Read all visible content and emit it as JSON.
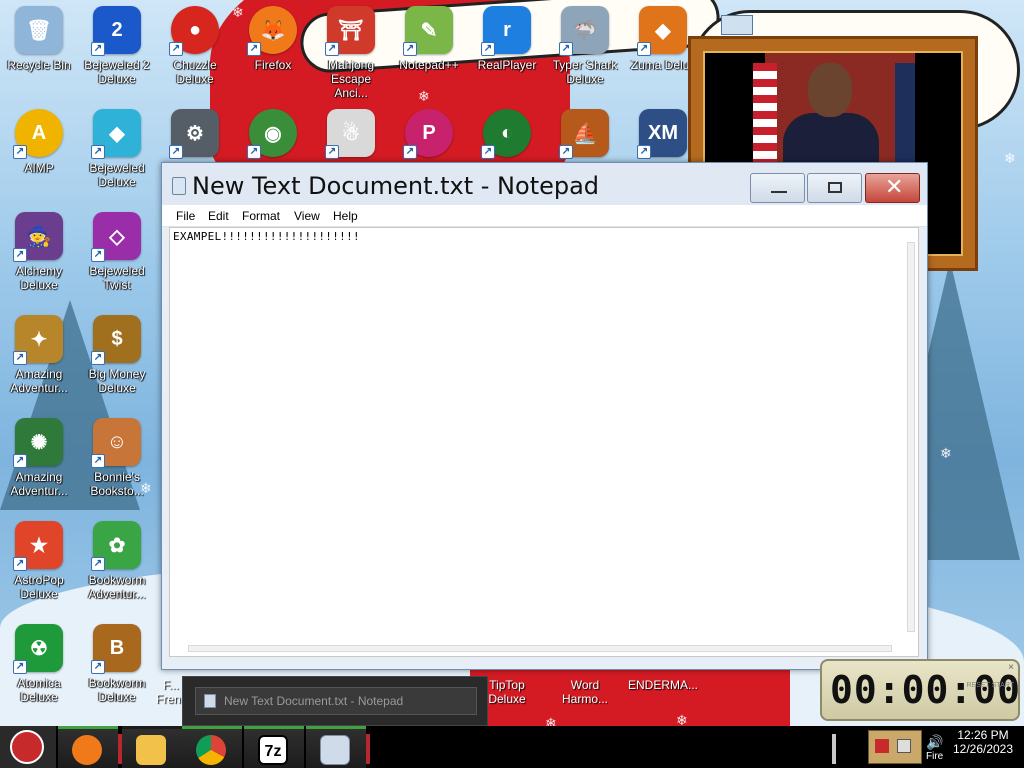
{
  "desktop_icons": [
    {
      "id": "recycle-bin",
      "label": "Recycle Bin",
      "glyph": "🗑",
      "color": "#8fb5d8"
    },
    {
      "id": "bejeweled-2-deluxe",
      "label": "Bejeweled 2 Deluxe",
      "glyph": "2",
      "color": "#1b58c9"
    },
    {
      "id": "chuzzle-deluxe",
      "label": "Chuzzle Deluxe",
      "glyph": "●",
      "color": "#d7261e"
    },
    {
      "id": "firefox",
      "label": "Firefox",
      "glyph": "🦊",
      "color": "#f07a1a"
    },
    {
      "id": "mahjong-escape",
      "label": "Mahjong Escape Anci...",
      "glyph": "⛩",
      "color": "#cf3a2a"
    },
    {
      "id": "notepad-plus-plus",
      "label": "Notepad++",
      "glyph": "✎",
      "color": "#7ab648"
    },
    {
      "id": "realplayer",
      "label": "RealPlayer",
      "glyph": "r",
      "color": "#1f7fe0"
    },
    {
      "id": "typer-shark-deluxe",
      "label": "Typer Shark Deluxe",
      "glyph": "🦈",
      "color": "#8ea4b8"
    },
    {
      "id": "zuma-deluxe",
      "label": "Zuma Delux",
      "glyph": "◆",
      "color": "#e0741b"
    },
    {
      "id": "aimp",
      "label": "AIMP",
      "glyph": "A",
      "color": "#f0b400"
    },
    {
      "id": "bejeweled-deluxe",
      "label": "Bejeweled Deluxe",
      "glyph": "◆",
      "color": "#2fb2d8"
    },
    {
      "id": "gear-app",
      "label": "",
      "glyph": "⚙",
      "color": "#555d66"
    },
    {
      "id": "chrome",
      "label": "",
      "glyph": "◉",
      "color": "#3a8e3a"
    },
    {
      "id": "yeti-game",
      "label": "",
      "glyph": "☃",
      "color": "#d9d9d9"
    },
    {
      "id": "p-game",
      "label": "",
      "glyph": "P",
      "color": "#c9226d"
    },
    {
      "id": "green-game",
      "label": "",
      "glyph": "◐",
      "color": "#1f7b2f"
    },
    {
      "id": "viking-game",
      "label": "",
      "glyph": "⛵",
      "color": "#b65a1c"
    },
    {
      "id": "xmplay",
      "label": "",
      "glyph": "XM",
      "color": "#2e4f86"
    },
    {
      "id": "alchemy-deluxe",
      "label": "Alchemy Deluxe",
      "glyph": "🧙",
      "color": "#6b3d8e"
    },
    {
      "id": "bejeweled-twist",
      "label": "Bejeweled Twist",
      "glyph": "◇",
      "color": "#9a2ea8"
    },
    {
      "id": "amazing-adventures-1",
      "label": "Amazing Adventur...",
      "glyph": "✦",
      "color": "#b8862a"
    },
    {
      "id": "big-money-deluxe",
      "label": "Big Money Deluxe",
      "glyph": "$",
      "color": "#a0701f"
    },
    {
      "id": "amazing-adventures-2",
      "label": "Amazing Adventur...",
      "glyph": "✺",
      "color": "#2f7a3a"
    },
    {
      "id": "bonnies-bookstore",
      "label": "Bonnie's Booksto...",
      "glyph": "☺",
      "color": "#c8753a"
    },
    {
      "id": "astropop-deluxe",
      "label": "AstroPop Deluxe",
      "glyph": "★",
      "color": "#e0452a"
    },
    {
      "id": "bookworm-adventures",
      "label": "Bookworm Adventur...",
      "glyph": "✿",
      "color": "#3aa544"
    },
    {
      "id": "atomica-deluxe",
      "label": "Atomica Deluxe",
      "glyph": "☢",
      "color": "#1f9a3a"
    },
    {
      "id": "bookworm-deluxe",
      "label": "Bookworm Deluxe",
      "glyph": "B",
      "color": "#a8691f"
    }
  ],
  "low_labels": {
    "partial": "F... Fren...",
    "tiptop": "TipTop Deluxe",
    "word_harmony": "Word Harmo...",
    "enderman": "ENDERMA..."
  },
  "notepad": {
    "title": "New Text Document.txt - Notepad",
    "menu": [
      "File",
      "Edit",
      "Format",
      "View",
      "Help"
    ],
    "content": "EXAMPEL!!!!!!!!!!!!!!!!!!!!",
    "close_glyph": "✕"
  },
  "thumbnail": {
    "title": "New Text Document.txt - Notepad"
  },
  "timer": {
    "display": "00:00:00",
    "close": "×",
    "side": "RESET START"
  },
  "taskbar": {
    "apps": [
      {
        "id": "santa-start",
        "color": "#c72a2a"
      },
      {
        "id": "firefox",
        "color": "#f07a1a"
      },
      {
        "id": "file-explorer",
        "color": "#f2c14a"
      },
      {
        "id": "chrome",
        "color": "#3a8e3a"
      },
      {
        "id": "7zip",
        "color": "#ffffff",
        "glyph": "7z"
      },
      {
        "id": "notepad",
        "color": "#cfdbe8"
      }
    ],
    "clock_time": "12:26 PM",
    "clock_date": "12/26/2023",
    "tray_label": "Fire"
  },
  "colors": {
    "accent_green": "#41a140",
    "close_red": "#c5463a",
    "frame_wood": "#b46a1f"
  }
}
